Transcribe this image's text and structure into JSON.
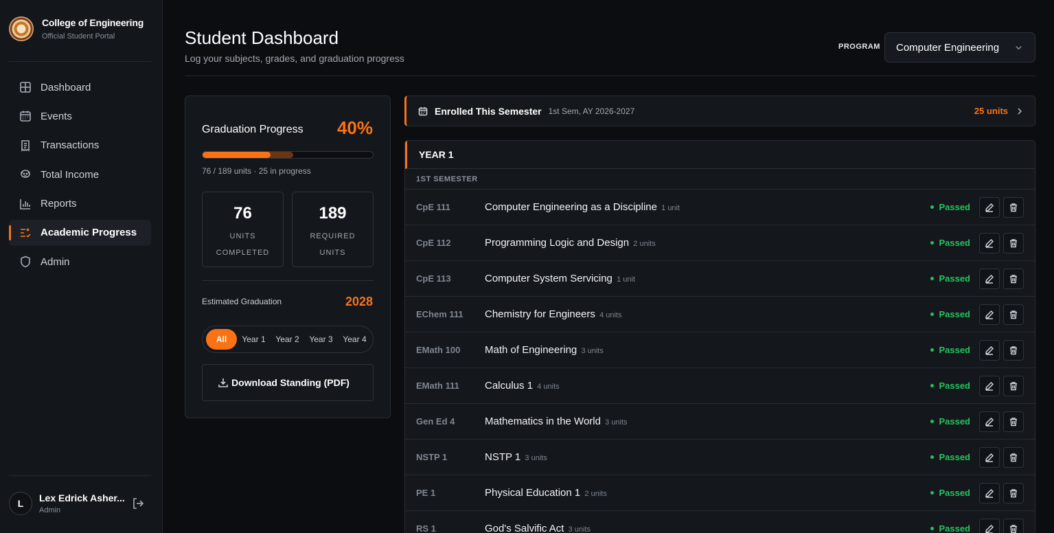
{
  "brand": {
    "title": "College of Engineering",
    "subtitle": "Official Student Portal"
  },
  "sidebar": {
    "items": [
      {
        "label": "Dashboard",
        "icon": "grid-icon"
      },
      {
        "label": "Events",
        "icon": "calendar-icon"
      },
      {
        "label": "Transactions",
        "icon": "receipt-icon"
      },
      {
        "label": "Total Income",
        "icon": "piggy-bank-icon"
      },
      {
        "label": "Reports",
        "icon": "bar-chart-icon"
      },
      {
        "label": "Academic Progress",
        "icon": "list-check-icon",
        "active": true
      },
      {
        "label": "Admin",
        "icon": "shield-icon"
      }
    ]
  },
  "user": {
    "initial": "L",
    "name": "Lex Edrick Asher...",
    "role": "Admin"
  },
  "header": {
    "title": "Student Dashboard",
    "subtitle": "Log your subjects, grades, and graduation progress",
    "program_label": "PROGRAM",
    "program_value": "Computer Engineering"
  },
  "progress": {
    "title": "Graduation Progress",
    "percent_label": "40%",
    "percent": 40,
    "in_progress_percent": 53.2,
    "units_text": "76 / 189 units · 25 in progress",
    "completed": {
      "value": "76",
      "label": "UNITS COMPLETED"
    },
    "required": {
      "value": "189",
      "label": "REQUIRED UNITS"
    },
    "est_label": "Estimated Graduation",
    "est_year": "2028",
    "filters": [
      "All",
      "Year 1",
      "Year 2",
      "Year 3",
      "Year 4"
    ],
    "active_filter": "All",
    "download_label": "Download Standing (PDF)"
  },
  "enrolled": {
    "title": "Enrolled This Semester",
    "semester": "1st Sem, AY 2026-2027",
    "units": "25 units"
  },
  "year": {
    "title": "YEAR 1",
    "semester": "1ST SEMESTER",
    "subjects": [
      {
        "code": "CpE 111",
        "name": "Computer Engineering as a Discipline",
        "units": "1 unit",
        "status": "Passed"
      },
      {
        "code": "CpE 112",
        "name": "Programming Logic and Design",
        "units": "2 units",
        "status": "Passed"
      },
      {
        "code": "CpE 113",
        "name": "Computer System Servicing",
        "units": "1 unit",
        "status": "Passed"
      },
      {
        "code": "EChem 111",
        "name": "Chemistry for Engineers",
        "units": "4 units",
        "status": "Passed"
      },
      {
        "code": "EMath 100",
        "name": "Math of Engineering",
        "units": "3 units",
        "status": "Passed"
      },
      {
        "code": "EMath 111",
        "name": "Calculus 1",
        "units": "4 units",
        "status": "Passed"
      },
      {
        "code": "Gen Ed 4",
        "name": "Mathematics in the World",
        "units": "3 units",
        "status": "Passed"
      },
      {
        "code": "NSTP 1",
        "name": "NSTP 1",
        "units": "3 units",
        "status": "Passed"
      },
      {
        "code": "PE 1",
        "name": "Physical Education 1",
        "units": "2 units",
        "status": "Passed"
      },
      {
        "code": "RS 1",
        "name": "God's Salvific Act",
        "units": "3 units",
        "status": "Passed"
      }
    ]
  },
  "colors": {
    "accent": "#f97316",
    "passed": "#22c55e",
    "background": "#0b0d11",
    "panel": "#14171c"
  }
}
